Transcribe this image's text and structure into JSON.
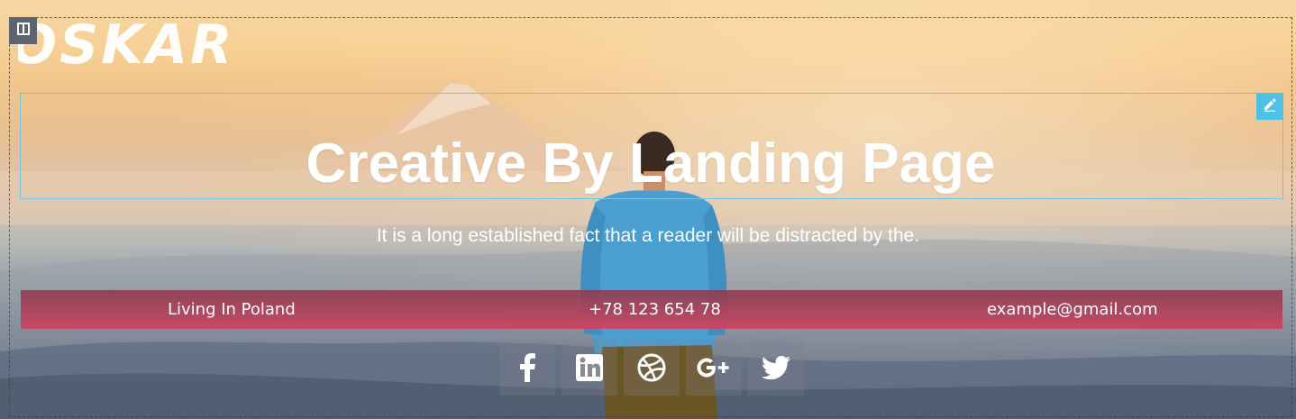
{
  "logo": {
    "text": "OSKAR"
  },
  "hero": {
    "title": "Creative By Landing Page",
    "subtitle": "It is a long established fact that a reader will be distracted by the."
  },
  "info_bar": {
    "location": "Living In Poland",
    "phone": "+78 123 654 78",
    "email": "example@gmail.com"
  },
  "social": [
    {
      "icon": "facebook-icon"
    },
    {
      "icon": "linkedin-icon"
    },
    {
      "icon": "dribbble-icon"
    },
    {
      "icon": "google-plus-icon"
    },
    {
      "icon": "twitter-icon"
    }
  ],
  "editor": {
    "section_handle_icon": "columns-icon",
    "edit_icon": "pencil-icon"
  },
  "colors": {
    "accent_bar_top": "#8c3c50",
    "accent_bar_bottom": "#cd4462",
    "edit_handle": "#4ec2e6",
    "section_handle": "#5c6470",
    "text": "#ffffff"
  }
}
